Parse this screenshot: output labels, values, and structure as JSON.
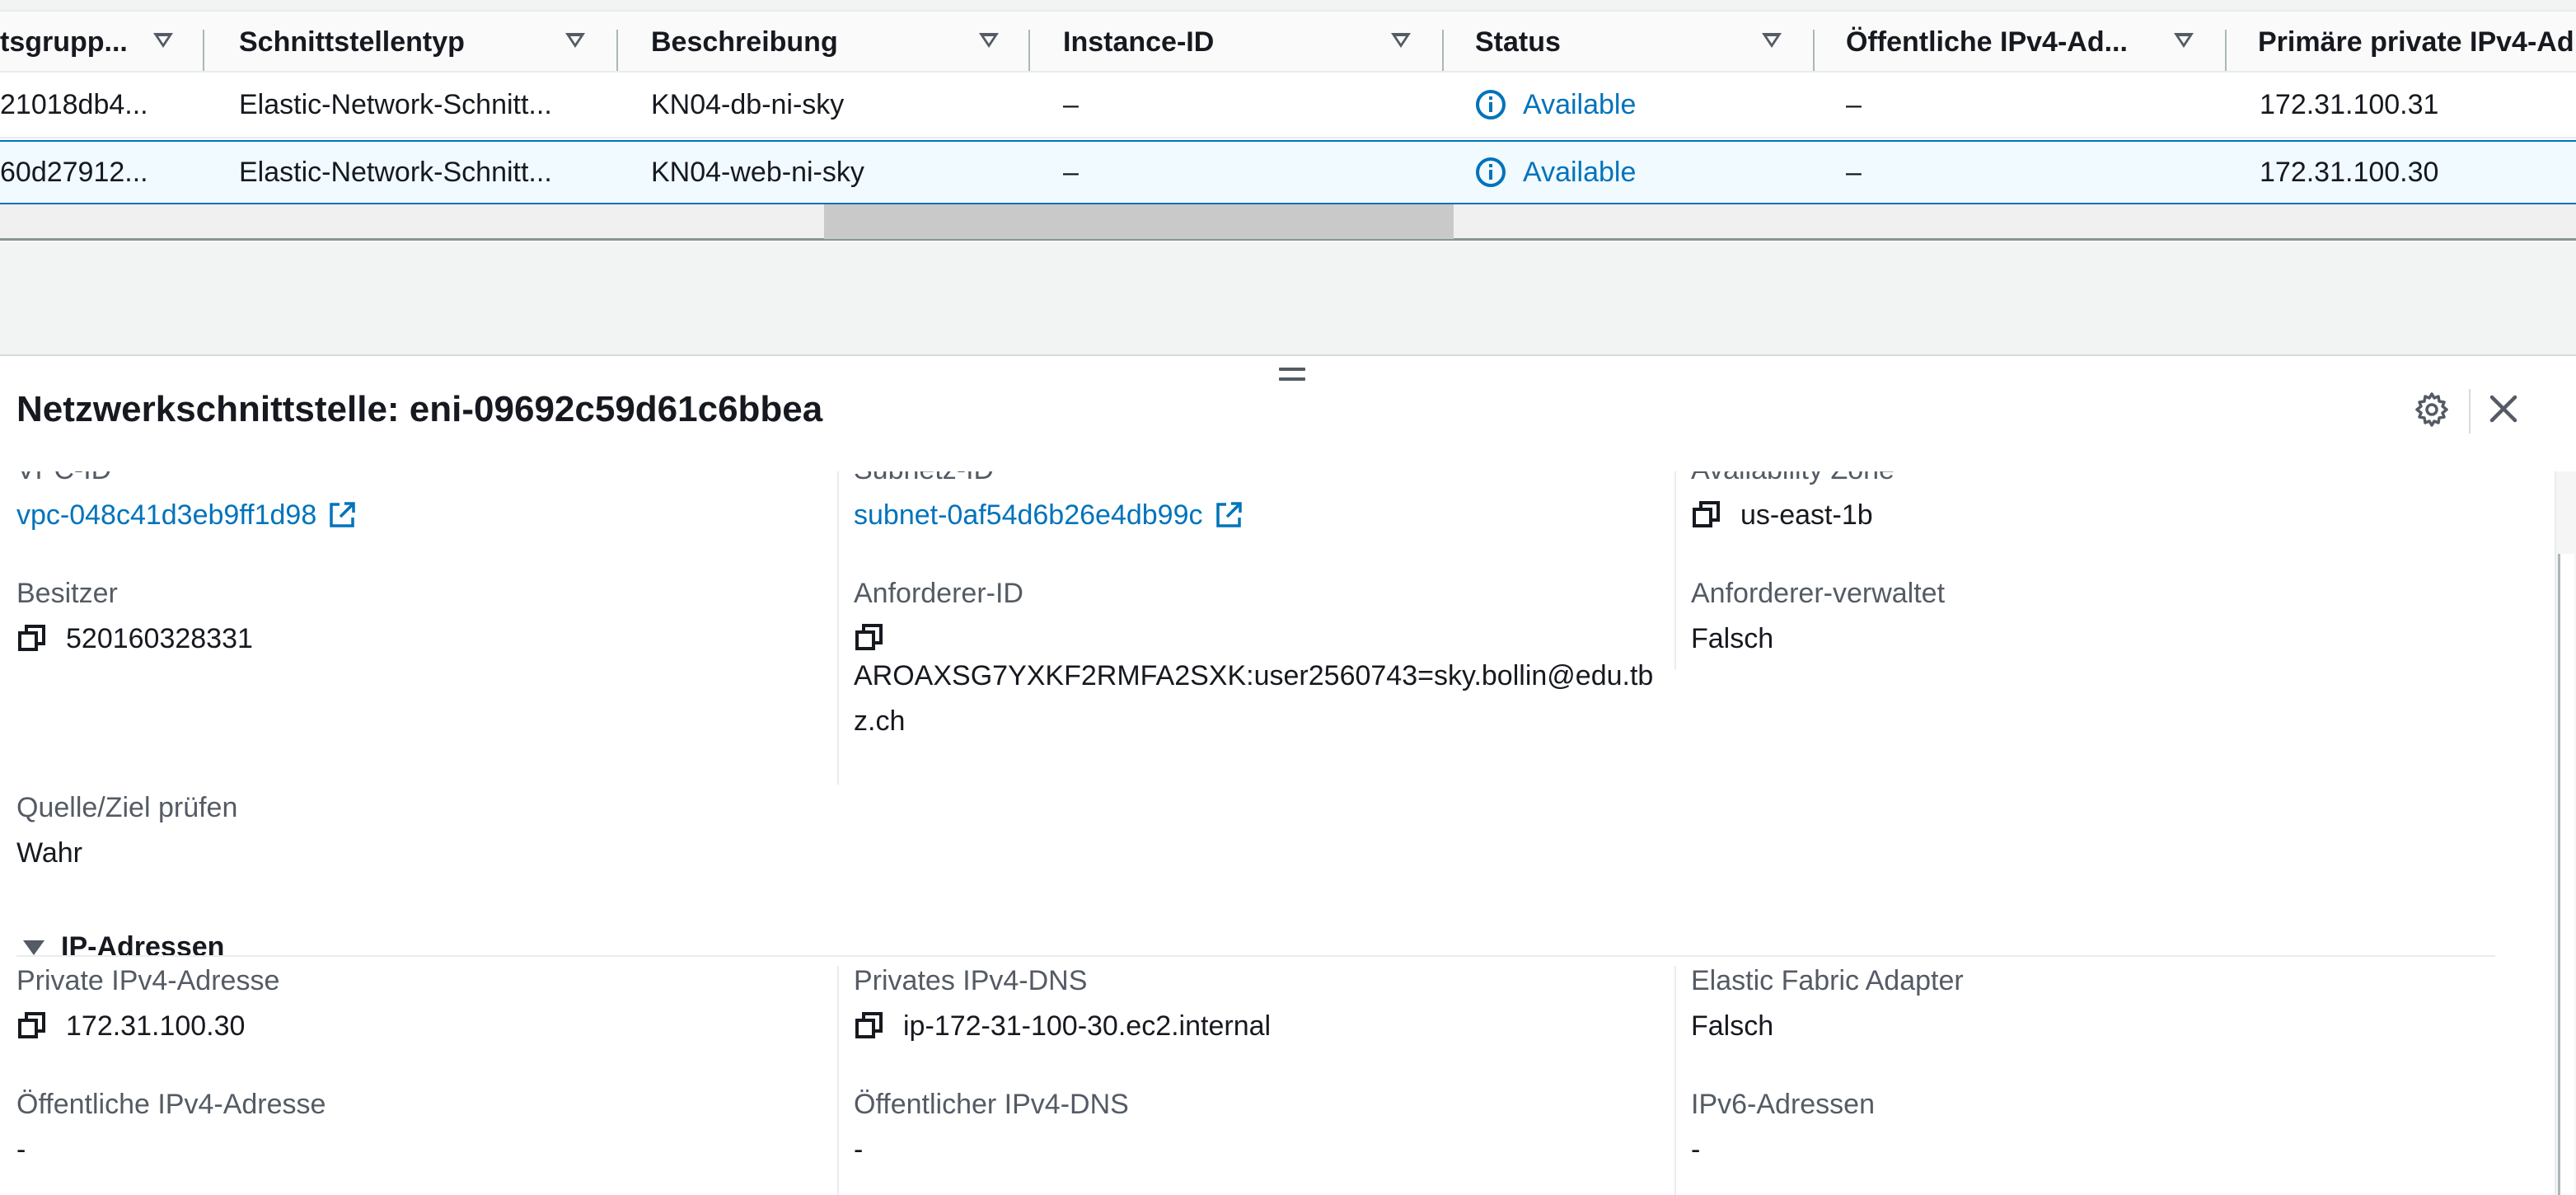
{
  "table": {
    "columns": [
      {
        "label": "tsgrupp..."
      },
      {
        "label": "Schnittstellentyp"
      },
      {
        "label": "Beschreibung"
      },
      {
        "label": "Instance-ID"
      },
      {
        "label": "Status"
      },
      {
        "label": "Öffentliche IPv4-Ad..."
      },
      {
        "label": "Primäre private IPv4-Ad"
      }
    ],
    "rows": [
      {
        "secgroup": "21018db4...",
        "type": "Elastic-Network-Schnitt...",
        "description": "KN04-db-ni-sky",
        "instance": "–",
        "status": "Available",
        "public_ip": "–",
        "private_ip": "172.31.100.31"
      },
      {
        "secgroup": "60d27912...",
        "type": "Elastic-Network-Schnitt...",
        "description": "KN04-web-ni-sky",
        "instance": "–",
        "status": "Available",
        "public_ip": "–",
        "private_ip": "172.31.100.30"
      }
    ],
    "selected_row": 2
  },
  "panel": {
    "title": "Netzwerkschnittstelle: eni-09692c59d61c6bbea",
    "settings_icon": "gear-icon",
    "close_icon": "close-icon",
    "details": {
      "vpc_id": {
        "label": "VPC-ID",
        "value": "vpc-048c41d3eb9ff1d98"
      },
      "subnet_id": {
        "label": "Subnetz-ID",
        "value": "subnet-0af54d6b26e4db99c"
      },
      "availability_zone": {
        "label": "Availability Zone",
        "value": "us-east-1b"
      },
      "owner": {
        "label": "Besitzer",
        "value": "520160328331"
      },
      "requester_id": {
        "label": "Anforderer-ID",
        "value": "AROAXSG7YXKF2RMFA2SXK:user2560743=sky.bollin@edu.tbz.ch"
      },
      "requester_managed": {
        "label": "Anforderer-verwaltet",
        "value": "Falsch"
      },
      "source_dest_check": {
        "label": "Quelle/Ziel prüfen",
        "value": "Wahr"
      }
    },
    "ip_section": {
      "title": "IP-Adressen",
      "private_ipv4": {
        "label": "Private IPv4-Adresse",
        "value": "172.31.100.30"
      },
      "private_dns": {
        "label": "Privates IPv4-DNS",
        "value": "ip-172-31-100-30.ec2.internal"
      },
      "efa": {
        "label": "Elastic Fabric Adapter",
        "value": "Falsch"
      },
      "public_ipv4": {
        "label": "Öffentliche IPv4-Adresse",
        "value": "-"
      },
      "public_dns": {
        "label": "Öffentlicher IPv4-DNS",
        "value": "-"
      },
      "ipv6": {
        "label": "IPv6-Adressen",
        "value": "-"
      }
    }
  },
  "colors": {
    "link": "#0073bb",
    "text": "#16191f",
    "label": "#545b64",
    "selected_row_bg": "#f1faff",
    "selected_row_border": "#0073bb"
  }
}
